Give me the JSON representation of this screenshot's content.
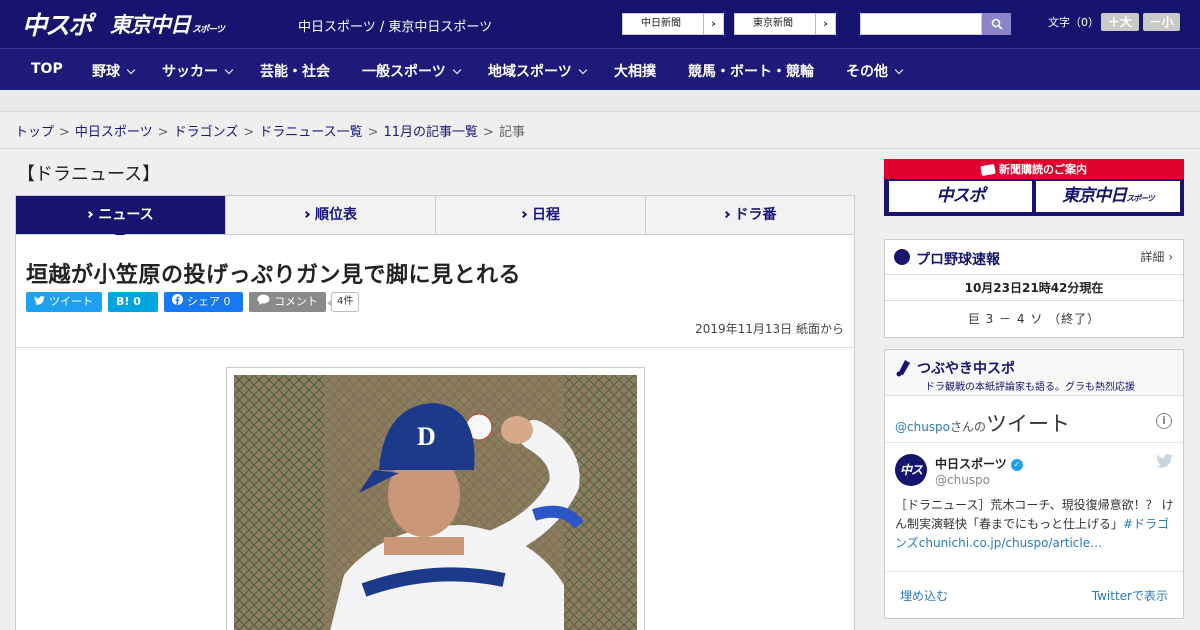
{
  "header": {
    "logo_chuspo": "中スポ",
    "logo_tokyo": "東京中日",
    "logo_tokyo_small": "スポーツ",
    "site_title": "中日スポーツ / 東京中日スポーツ",
    "ext_links": [
      "中日新聞",
      "東京新聞"
    ],
    "search_placeholder": "",
    "font_size_label": "文字（0）",
    "font_bigger": "＋大",
    "font_smaller": "－小"
  },
  "nav": {
    "items": [
      {
        "label": "TOP",
        "dropdown": false
      },
      {
        "label": "野球",
        "dropdown": true
      },
      {
        "label": "サッカー",
        "dropdown": true
      },
      {
        "label": "芸能・社会",
        "dropdown": false
      },
      {
        "label": "一般スポーツ",
        "dropdown": true
      },
      {
        "label": "地域スポーツ",
        "dropdown": true
      },
      {
        "label": "大相撲",
        "dropdown": false
      },
      {
        "label": "競馬・ボート・競輪",
        "dropdown": false
      },
      {
        "label": "その他",
        "dropdown": true
      }
    ]
  },
  "breadcrumb": {
    "items": [
      "トップ",
      "中日スポーツ",
      "ドラゴンズ",
      "ドラニュース一覧",
      "11月の記事一覧"
    ],
    "current": "記事",
    "separator": ">"
  },
  "section": {
    "title": "【ドラニュース】",
    "tabs": [
      "ニュース",
      "順位表",
      "日程",
      "ドラ番"
    ],
    "active_tab": 0
  },
  "article": {
    "headline": "垣越が小笠原の投げっぷりガン見で脚に見とれる",
    "share": {
      "tweet": "ツイート",
      "hatena_label": "B!",
      "hatena_count": "0",
      "facebook": "シェア",
      "facebook_count": "0",
      "comment": "コメント",
      "comment_count": "4件"
    },
    "date": "2019年11月13日 紙面から"
  },
  "sidebar": {
    "ad": {
      "title": "新聞購読のご案内",
      "left": "中スポ",
      "right": "東京中日",
      "right_small": "スポーツ"
    },
    "scores": {
      "title": "プロ野球速報",
      "detail": "詳細 ›",
      "time": "10月23日21時42分現在",
      "result": "巨 3 － 4 ソ （終了）"
    },
    "tweets": {
      "title": "つぶやき中スポ",
      "subtitle": "ドラ観戦の本紙評論家も語る。グラも熱烈応援",
      "handle": "@chuspo",
      "handle_suffix": "さんの",
      "timeline_word": "ツイート",
      "avatar_text": "中スポ",
      "name": "中日スポーツ",
      "user_handle": "@chuspo",
      "text": "［ドラニュース］荒木コーチ、現役復帰意欲！？ けん制実演軽快「春までにもっと仕上げる」",
      "hashtag": "#ドラゴンズ",
      "link": "chunichi.co.jp/chuspo/article…",
      "embed": "埋め込む",
      "view": "Twitterで表示"
    }
  },
  "colors": {
    "brand_navy": "#16146e",
    "nav_bg": "#1e1a7a",
    "ad_red": "#e0002d",
    "twitter_blue": "#1da1f2",
    "link_blue": "#2b7bb9"
  }
}
